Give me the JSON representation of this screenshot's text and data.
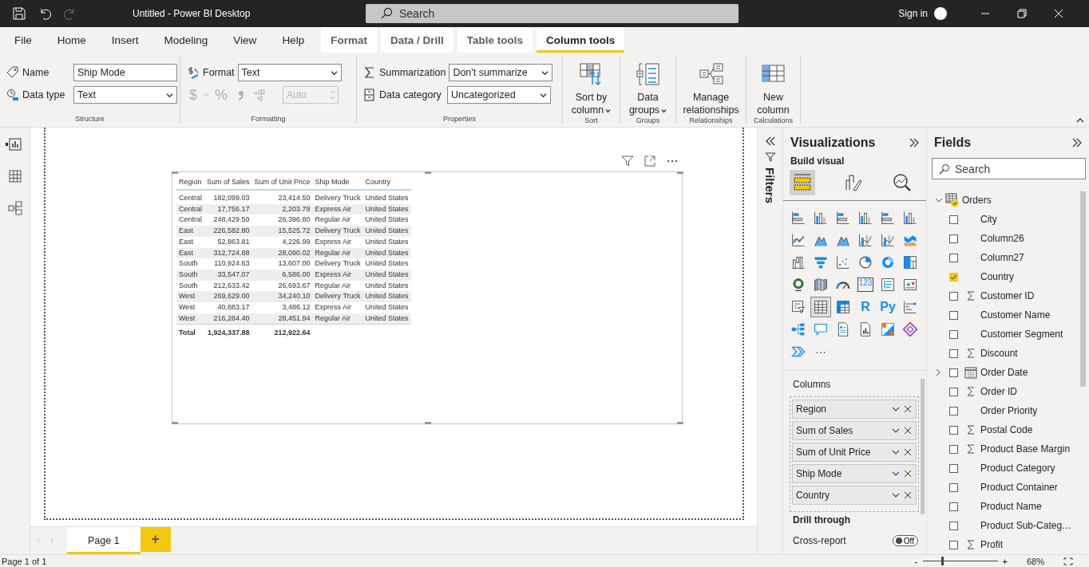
{
  "title_bar": {
    "title": "Untitled - Power BI Desktop",
    "search": {
      "placeholder": "Search"
    },
    "sign_in": "Sign in"
  },
  "ribbon_tabs": [
    {
      "label": "File",
      "selected": false,
      "contextual": false
    },
    {
      "label": "Home",
      "selected": false,
      "contextual": false
    },
    {
      "label": "Insert",
      "selected": false,
      "contextual": false
    },
    {
      "label": "Modeling",
      "selected": false,
      "contextual": false
    },
    {
      "label": "View",
      "selected": false,
      "contextual": false
    },
    {
      "label": "Help",
      "selected": false,
      "contextual": false
    },
    {
      "label": "Format",
      "selected": false,
      "contextual": true
    },
    {
      "label": "Data / Drill",
      "selected": false,
      "contextual": true
    },
    {
      "label": "Table tools",
      "selected": false,
      "contextual": true
    },
    {
      "label": "Column tools",
      "selected": true,
      "contextual": true
    }
  ],
  "structure": {
    "group": "Structure",
    "name_label": "Name",
    "name_value": "Ship Mode",
    "data_type_label": "Data type",
    "data_type_value": "Text"
  },
  "formatting": {
    "group": "Formatting",
    "format_label": "Format",
    "format_value": "Text",
    "buttons": [
      {
        "kind": "text",
        "label": "$",
        "disabled": true
      },
      {
        "kind": "caret",
        "disabled": true
      },
      {
        "kind": "text",
        "label": "%",
        "disabled": true
      },
      {
        "kind": "comma",
        "disabled": true
      },
      {
        "kind": "decimal",
        "disabled": true
      }
    ],
    "decimals": {
      "value": "Auto",
      "disabled": true
    }
  },
  "properties": {
    "group": "Properties",
    "summarization_label": "Summarization",
    "summarization_value": "Don't summarize",
    "category_label": "Data category",
    "category_value": "Uncategorized"
  },
  "big_buttons": [
    {
      "kind": "sort",
      "label": "Sort by column",
      "caret": true,
      "group": "Sort"
    },
    {
      "kind": "groups",
      "label": "Data groups",
      "caret": true,
      "group": "Groups"
    },
    {
      "kind": "relationships",
      "label": "Manage relationships",
      "caret": false,
      "group": "Relationships"
    },
    {
      "kind": "new-column",
      "label": "New column",
      "caret": false,
      "group": "Calculations"
    }
  ],
  "table": {
    "columns": [
      {
        "label": "Region",
        "kind": "category"
      },
      {
        "label": "Sum of Sales",
        "kind": "measure"
      },
      {
        "label": "Sum of Unit Price",
        "kind": "measure"
      },
      {
        "label": "Ship Mode",
        "kind": "category"
      },
      {
        "label": "Country",
        "kind": "category"
      }
    ],
    "rows": [
      [
        "Central",
        "182,099.03",
        "23,414.50",
        "Delivery Truck",
        "United States"
      ],
      [
        "Central",
        "17,756.17",
        "2,203.78",
        "Express Air",
        "United States"
      ],
      [
        "Central",
        "248,429.50",
        "26,396.80",
        "Regular Air",
        "United States"
      ],
      [
        "East",
        "226,582.80",
        "15,525.72",
        "Delivery Truck",
        "United States"
      ],
      [
        "East",
        "52,863.81",
        "4,226.99",
        "Express Air",
        "United States"
      ],
      [
        "East",
        "312,724.88",
        "28,090.02",
        "Regular Air",
        "United States"
      ],
      [
        "South",
        "110,924.63",
        "13,607.00",
        "Delivery Truck",
        "United States"
      ],
      [
        "South",
        "33,547.07",
        "6,586.00",
        "Express Air",
        "United States"
      ],
      [
        "South",
        "212,633.42",
        "26,693.67",
        "Regular Air",
        "United States"
      ],
      [
        "West",
        "269,629.00",
        "34,240.10",
        "Delivery Truck",
        "United States"
      ],
      [
        "West",
        "40,883.17",
        "3,486.12",
        "Express Air",
        "United States"
      ],
      [
        "West",
        "216,264.40",
        "28,451.94",
        "Regular Air",
        "United States"
      ]
    ],
    "total": [
      "Total",
      "1,924,337.88",
      "212,922.64"
    ]
  },
  "filters": {
    "label": "Filters"
  },
  "visualizations": {
    "title": "Visualizations",
    "subtitle": "Build visual",
    "modes": [
      {
        "kind": "build",
        "selected": true
      },
      {
        "kind": "format",
        "selected": false
      },
      {
        "kind": "analytics",
        "selected": false
      }
    ],
    "types": [
      {
        "kind": "bar-h",
        "selected": false
      },
      {
        "kind": "bar-v",
        "selected": false
      },
      {
        "kind": "bar-h",
        "selected": false
      },
      {
        "kind": "bar-v",
        "selected": false
      },
      {
        "kind": "bar-h",
        "selected": false
      },
      {
        "kind": "bar-v",
        "selected": false
      },
      {
        "kind": "line",
        "selected": false
      },
      {
        "kind": "area",
        "selected": false
      },
      {
        "kind": "area",
        "selected": false
      },
      {
        "kind": "combo",
        "selected": false
      },
      {
        "kind": "combo",
        "selected": false
      },
      {
        "kind": "ribbon",
        "selected": false
      },
      {
        "kind": "waterfall",
        "selected": false
      },
      {
        "kind": "funnel",
        "selected": false
      },
      {
        "kind": "scatter",
        "selected": false
      },
      {
        "kind": "pie",
        "selected": false
      },
      {
        "kind": "donut",
        "selected": false
      },
      {
        "kind": "treemap",
        "selected": false
      },
      {
        "kind": "globe",
        "selected": false
      },
      {
        "kind": "shape-map",
        "selected": false
      },
      {
        "kind": "gauge",
        "selected": false
      },
      {
        "kind": "card",
        "label": "123",
        "selected": false
      },
      {
        "kind": "multirow",
        "selected": false
      },
      {
        "kind": "kpi",
        "selected": false
      },
      {
        "kind": "slicer",
        "selected": false
      },
      {
        "kind": "table",
        "selected": true
      },
      {
        "kind": "matrix",
        "selected": false
      },
      {
        "kind": "glyph",
        "label": "R",
        "selected": false
      },
      {
        "kind": "glyph",
        "label": "Py",
        "selected": false
      },
      {
        "kind": "decomp",
        "selected": false
      },
      {
        "kind": "hierarchy",
        "selected": false
      },
      {
        "kind": "bubble",
        "selected": false
      },
      {
        "kind": "paginated",
        "selected": false
      },
      {
        "kind": "narrative",
        "selected": false
      },
      {
        "kind": "arcgis",
        "selected": false
      },
      {
        "kind": "diamond",
        "selected": false
      },
      {
        "kind": "chevrons",
        "selected": false
      },
      {
        "kind": "more",
        "label": "···",
        "selected": false
      }
    ],
    "well": {
      "label": "Columns",
      "fields": [
        "Region",
        "Sum of Sales",
        "Sum of Unit Price",
        "Ship Mode",
        "Country"
      ]
    },
    "drill_through": "Drill through",
    "cross_report": {
      "label": "Cross-report",
      "on": false,
      "state_label": "Off"
    }
  },
  "fields": {
    "title": "Fields",
    "search": {
      "placeholder": "Search"
    },
    "tables": [
      {
        "name": "Orders",
        "expanded": true,
        "children": [
          {
            "name": "City",
            "kind": "text",
            "checked": false
          },
          {
            "name": "Column26",
            "kind": "text",
            "checked": false
          },
          {
            "name": "Column27",
            "kind": "text",
            "checked": false
          },
          {
            "name": "Country",
            "kind": "text",
            "checked": true
          },
          {
            "name": "Customer ID",
            "kind": "sum",
            "checked": false
          },
          {
            "name": "Customer Name",
            "kind": "text",
            "checked": false
          },
          {
            "name": "Customer Segment",
            "kind": "text",
            "checked": false
          },
          {
            "name": "Discount",
            "kind": "sum",
            "checked": false
          },
          {
            "name": "Order Date",
            "kind": "date",
            "checked": false
          },
          {
            "name": "Order ID",
            "kind": "sum",
            "checked": false
          },
          {
            "name": "Order Priority",
            "kind": "text",
            "checked": false
          },
          {
            "name": "Postal Code",
            "kind": "sum",
            "checked": false
          },
          {
            "name": "Product Base Margin",
            "kind": "sum",
            "checked": false
          },
          {
            "name": "Product Category",
            "kind": "text",
            "checked": false
          },
          {
            "name": "Product Container",
            "kind": "text",
            "checked": false
          },
          {
            "name": "Product Name",
            "kind": "text",
            "checked": false
          },
          {
            "name": "Product Sub-Categ…",
            "kind": "text",
            "checked": false
          },
          {
            "name": "Profit",
            "kind": "sum",
            "checked": false
          }
        ]
      }
    ]
  },
  "pages": [
    {
      "label": "Page 1",
      "selected": true
    }
  ],
  "add_page": "+",
  "status_bar": {
    "page_info": "Page 1 of 1",
    "zoom_out": "-",
    "zoom_in": "+",
    "level": 0.25,
    "zoom": "68%"
  }
}
